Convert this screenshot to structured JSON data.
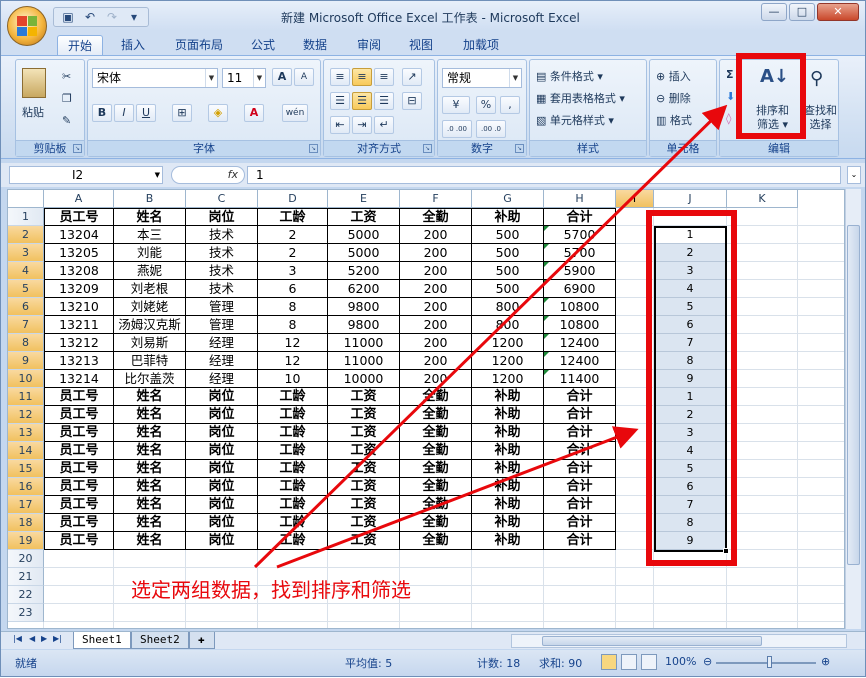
{
  "window": {
    "title": "新建 Microsoft Office Excel 工作表 - Microsoft Excel",
    "min_label": "—",
    "max_label": "□",
    "close_label": "✕"
  },
  "tabs": [
    "开始",
    "插入",
    "页面布局",
    "公式",
    "数据",
    "审阅",
    "视图",
    "加载项"
  ],
  "active_tab": "开始",
  "ribbon": {
    "clipboard": {
      "label": "剪贴板",
      "paste": "粘贴"
    },
    "font": {
      "label": "字体",
      "font_name": "宋体",
      "font_size": "11",
      "bold": "B",
      "italic": "I",
      "underline": "U",
      "font_color_glyph": "A",
      "grow": "A",
      "shrink": "A",
      "phonetic": "wén"
    },
    "alignment": {
      "label": "对齐方式"
    },
    "number": {
      "label": "数字",
      "format": "常规",
      "percent": "%",
      "comma": ",",
      "inc_decimal": ".0 .00",
      "dec_decimal": ".00 .0"
    },
    "styles": {
      "label": "样式",
      "conditional": "条件格式",
      "table": "套用表格格式",
      "cell": "单元格样式"
    },
    "cells": {
      "label": "单元格",
      "insert": "插入",
      "delete": "删除",
      "format": "格式"
    },
    "editing": {
      "label": "编辑",
      "sum_glyph": "Σ",
      "sort_filter_line1": "排序和",
      "sort_filter_line2": "筛选",
      "find_line1": "查找和",
      "find_line2": "选择"
    }
  },
  "formula_bar": {
    "name_box": "I2",
    "fx": "fx",
    "value": "1"
  },
  "columns": [
    "A",
    "B",
    "C",
    "D",
    "E",
    "F",
    "G",
    "H",
    "I",
    "J",
    "K"
  ],
  "selected_column": "I",
  "rows": [
    [
      "员工号",
      "姓名",
      "岗位",
      "工龄",
      "工资",
      "全勤",
      "补助",
      "合计"
    ],
    [
      "13204",
      "本三",
      "技术",
      "2",
      "5000",
      "200",
      "500",
      "5700"
    ],
    [
      "13205",
      "刘能",
      "技术",
      "2",
      "5000",
      "200",
      "500",
      "5700"
    ],
    [
      "13208",
      "燕妮",
      "技术",
      "3",
      "5200",
      "200",
      "500",
      "5900"
    ],
    [
      "13209",
      "刘老根",
      "技术",
      "6",
      "6200",
      "200",
      "500",
      "6900"
    ],
    [
      "13210",
      "刘姥姥",
      "管理",
      "8",
      "9800",
      "200",
      "800",
      "10800"
    ],
    [
      "13211",
      "汤姆汉克斯",
      "管理",
      "8",
      "9800",
      "200",
      "800",
      "10800"
    ],
    [
      "13212",
      "刘易斯",
      "经理",
      "12",
      "11000",
      "200",
      "1200",
      "12400"
    ],
    [
      "13213",
      "巴菲特",
      "经理",
      "12",
      "11000",
      "200",
      "1200",
      "12400"
    ],
    [
      "13214",
      "比尔盖茨",
      "经理",
      "10",
      "10000",
      "200",
      "1200",
      "11400"
    ],
    [
      "员工号",
      "姓名",
      "岗位",
      "工龄",
      "工资",
      "全勤",
      "补助",
      "合计"
    ],
    [
      "员工号",
      "姓名",
      "岗位",
      "工龄",
      "工资",
      "全勤",
      "补助",
      "合计"
    ],
    [
      "员工号",
      "姓名",
      "岗位",
      "工龄",
      "工资",
      "全勤",
      "补助",
      "合计"
    ],
    [
      "员工号",
      "姓名",
      "岗位",
      "工龄",
      "工资",
      "全勤",
      "补助",
      "合计"
    ],
    [
      "员工号",
      "姓名",
      "岗位",
      "工龄",
      "工资",
      "全勤",
      "补助",
      "合计"
    ],
    [
      "员工号",
      "姓名",
      "岗位",
      "工龄",
      "工资",
      "全勤",
      "补助",
      "合计"
    ],
    [
      "员工号",
      "姓名",
      "岗位",
      "工龄",
      "工资",
      "全勤",
      "补助",
      "合计"
    ],
    [
      "员工号",
      "姓名",
      "岗位",
      "工龄",
      "工资",
      "全勤",
      "补助",
      "合计"
    ],
    [
      "员工号",
      "姓名",
      "岗位",
      "工龄",
      "工资",
      "全勤",
      "补助",
      "合计"
    ]
  ],
  "col_i_values": [
    "1",
    "2",
    "3",
    "4",
    "5",
    "6",
    "7",
    "8",
    "9",
    "1",
    "2",
    "3",
    "4",
    "5",
    "6",
    "7",
    "8",
    "9"
  ],
  "row_numbers": [
    "1",
    "2",
    "3",
    "4",
    "5",
    "6",
    "7",
    "8",
    "9",
    "10",
    "11",
    "12",
    "13",
    "14",
    "15",
    "16",
    "17",
    "18",
    "19",
    "20",
    "21",
    "22",
    "23"
  ],
  "annotation": "选定两组数据，找到排序和筛选",
  "sheet_tabs": [
    "Sheet1",
    "Sheet2"
  ],
  "active_sheet": "Sheet1",
  "status": {
    "ready": "就绪",
    "average": "平均值: 5",
    "count": "计数: 18",
    "sum": "求和: 90",
    "zoom": "100%"
  },
  "colors": {
    "accent_red": "#e8080c",
    "selection_fill": "#dbe5f1"
  }
}
